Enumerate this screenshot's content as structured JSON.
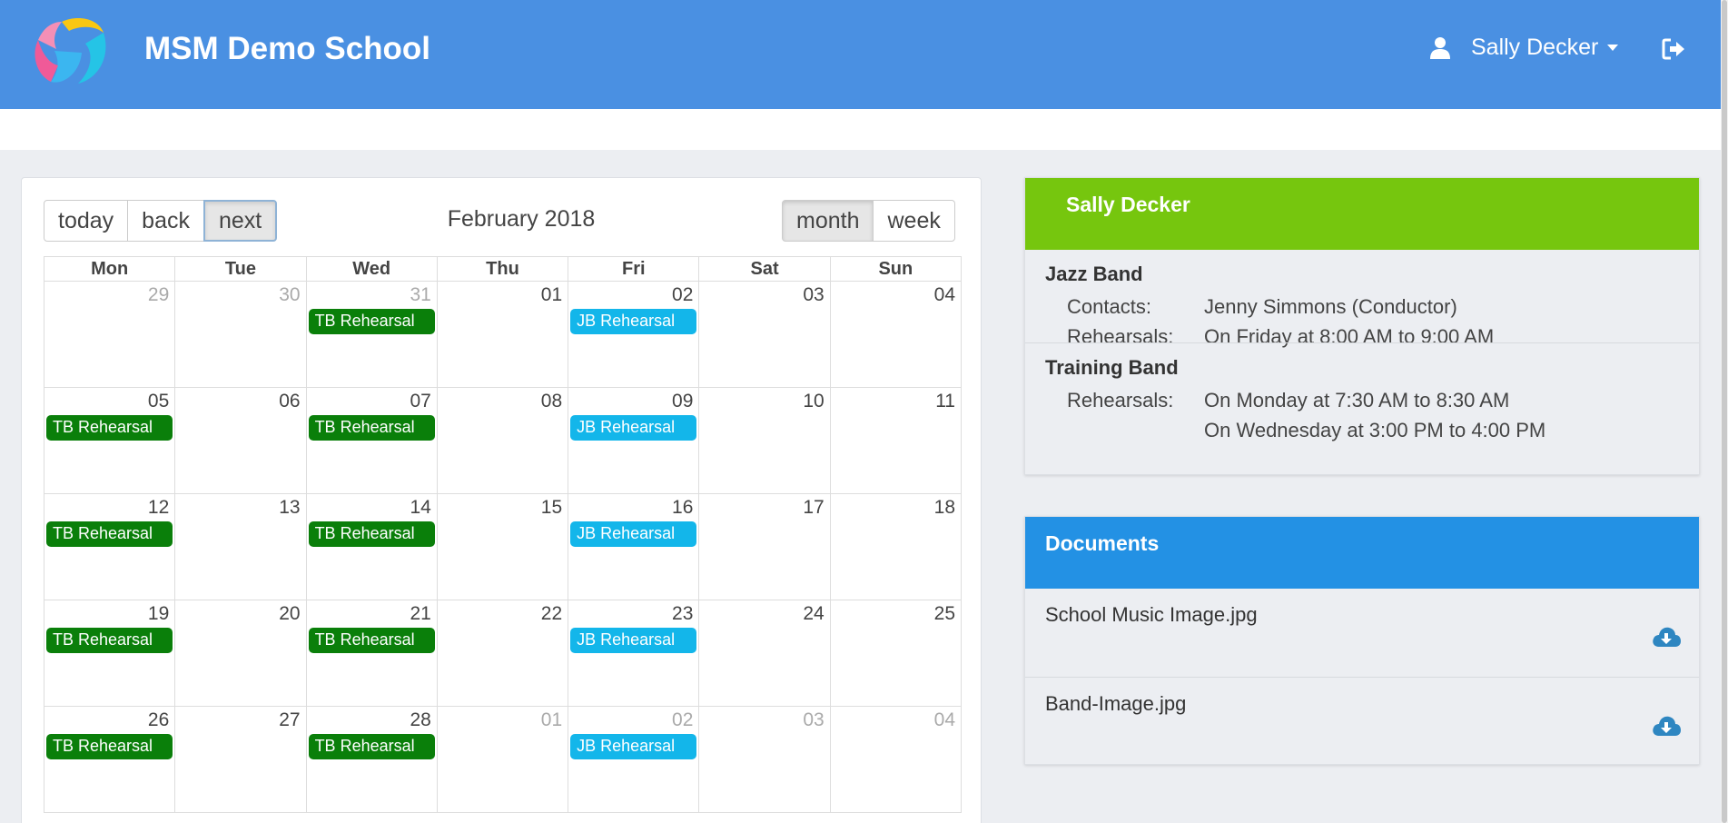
{
  "header": {
    "app_title": "MSM Demo School",
    "user_name": "Sally Decker",
    "icons": {
      "user": "user-icon",
      "caret": "caret-down-icon",
      "logout": "sign-out-icon",
      "logo": "logo-icon"
    }
  },
  "calendar": {
    "label": "February 2018",
    "nav_buttons": [
      "today",
      "back",
      "next"
    ],
    "view_buttons": [
      "month",
      "week"
    ],
    "active_view": "month",
    "weekdays": [
      "Mon",
      "Tue",
      "Wed",
      "Thu",
      "Fri",
      "Sat",
      "Sun"
    ],
    "weeks": [
      [
        {
          "day": "29",
          "off": true,
          "events": []
        },
        {
          "day": "30",
          "off": true,
          "events": []
        },
        {
          "day": "31",
          "off": true,
          "events": [
            {
              "title": "TB Rehearsal",
              "type": "tb"
            }
          ]
        },
        {
          "day": "01",
          "off": false,
          "events": []
        },
        {
          "day": "02",
          "off": false,
          "events": [
            {
              "title": "JB Rehearsal",
              "type": "jb"
            }
          ]
        },
        {
          "day": "03",
          "off": false,
          "events": []
        },
        {
          "day": "04",
          "off": false,
          "events": []
        }
      ],
      [
        {
          "day": "05",
          "off": false,
          "events": [
            {
              "title": "TB Rehearsal",
              "type": "tb"
            }
          ]
        },
        {
          "day": "06",
          "off": false,
          "events": []
        },
        {
          "day": "07",
          "off": false,
          "events": [
            {
              "title": "TB Rehearsal",
              "type": "tb"
            }
          ]
        },
        {
          "day": "08",
          "off": false,
          "events": []
        },
        {
          "day": "09",
          "off": false,
          "events": [
            {
              "title": "JB Rehearsal",
              "type": "jb"
            }
          ]
        },
        {
          "day": "10",
          "off": false,
          "events": []
        },
        {
          "day": "11",
          "off": false,
          "events": []
        }
      ],
      [
        {
          "day": "12",
          "off": false,
          "events": [
            {
              "title": "TB Rehearsal",
              "type": "tb"
            }
          ]
        },
        {
          "day": "13",
          "off": false,
          "events": []
        },
        {
          "day": "14",
          "off": false,
          "events": [
            {
              "title": "TB Rehearsal",
              "type": "tb"
            }
          ]
        },
        {
          "day": "15",
          "off": false,
          "events": []
        },
        {
          "day": "16",
          "off": false,
          "events": [
            {
              "title": "JB Rehearsal",
              "type": "jb"
            }
          ]
        },
        {
          "day": "17",
          "off": false,
          "events": []
        },
        {
          "day": "18",
          "off": false,
          "events": []
        }
      ],
      [
        {
          "day": "19",
          "off": false,
          "events": [
            {
              "title": "TB Rehearsal",
              "type": "tb"
            }
          ]
        },
        {
          "day": "20",
          "off": false,
          "events": []
        },
        {
          "day": "21",
          "off": false,
          "events": [
            {
              "title": "TB Rehearsal",
              "type": "tb"
            }
          ]
        },
        {
          "day": "22",
          "off": false,
          "events": []
        },
        {
          "day": "23",
          "off": false,
          "events": [
            {
              "title": "JB Rehearsal",
              "type": "jb"
            }
          ]
        },
        {
          "day": "24",
          "off": false,
          "events": []
        },
        {
          "day": "25",
          "off": false,
          "events": []
        }
      ],
      [
        {
          "day": "26",
          "off": false,
          "events": [
            {
              "title": "TB Rehearsal",
              "type": "tb"
            }
          ]
        },
        {
          "day": "27",
          "off": false,
          "events": []
        },
        {
          "day": "28",
          "off": false,
          "events": [
            {
              "title": "TB Rehearsal",
              "type": "tb"
            }
          ]
        },
        {
          "day": "01",
          "off": true,
          "events": []
        },
        {
          "day": "02",
          "off": true,
          "events": [
            {
              "title": "JB Rehearsal",
              "type": "jb"
            }
          ]
        },
        {
          "day": "03",
          "off": true,
          "events": []
        },
        {
          "day": "04",
          "off": true,
          "events": []
        }
      ]
    ]
  },
  "student_panel": {
    "title": "Sally Decker",
    "groups": [
      {
        "name": "Jazz Band",
        "rows": [
          {
            "key": "Contacts:",
            "value": "Jenny Simmons (Conductor)"
          },
          {
            "key": "Rehearsals:",
            "value": "On Friday at 8:00 AM to 9:00 AM"
          }
        ]
      },
      {
        "name": "Training Band",
        "rows": [
          {
            "key": "Rehearsals:",
            "value": "On Monday at 7:30 AM to 8:30 AM"
          },
          {
            "key": "",
            "value": "On Wednesday at 3:00 PM to 4:00 PM"
          }
        ]
      }
    ]
  },
  "documents": {
    "title": "Documents",
    "items": [
      {
        "name": "School Music Image.jpg",
        "icon": "cloud-download-icon"
      },
      {
        "name": "Band-Image.jpg",
        "icon": "cloud-download-icon"
      }
    ]
  },
  "colors": {
    "header_bg": "#4a90e2",
    "student_header": "#76c60e",
    "docs_header": "#2391e4",
    "tb_event": "#0a7f0a",
    "jb_event": "#13b6ea"
  }
}
